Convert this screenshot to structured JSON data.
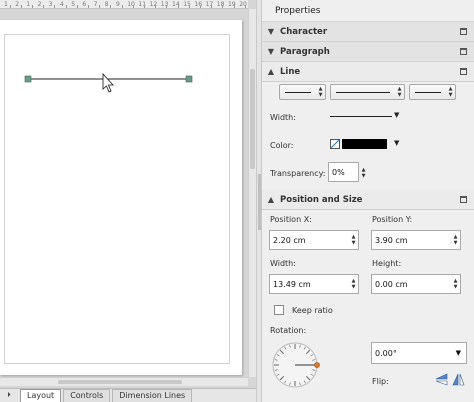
{
  "ruler": {
    "ticks": [
      "1",
      "2",
      "1",
      "2",
      "3",
      "4",
      "5",
      "6",
      "7",
      "8",
      "9",
      "10",
      "11",
      "12",
      "13",
      "14",
      "15",
      "16",
      "17",
      "18",
      "19",
      "20"
    ]
  },
  "sheet_tabs": [
    {
      "label": "Layout",
      "active": true
    },
    {
      "label": "Controls",
      "active": false
    },
    {
      "label": "Dimension Lines",
      "active": false
    }
  ],
  "sidebar": {
    "title": "Properties",
    "sections": {
      "character": "Character",
      "paragraph": "Paragraph",
      "line": "Line",
      "position_size": "Position and Size"
    },
    "line": {
      "width_label": "Width:",
      "color_label": "Color:",
      "color_value": "#000000",
      "transparency_label": "Transparency:",
      "transparency_value": "0%"
    },
    "position": {
      "pos_x_label": "Position X:",
      "pos_x_value": "2.20 cm",
      "pos_y_label": "Position Y:",
      "pos_y_value": "3.90 cm",
      "width_label": "Width:",
      "width_value": "13.49 cm",
      "height_label": "Height:",
      "height_value": "0.00 cm",
      "keep_ratio_label": "Keep ratio",
      "keep_ratio_checked": false,
      "rotation_label": "Rotation:",
      "rotation_value": "0.00°",
      "flip_label": "Flip:"
    }
  },
  "colors": {
    "accent": "#4a6fa5",
    "handle": "#6b9a86"
  }
}
